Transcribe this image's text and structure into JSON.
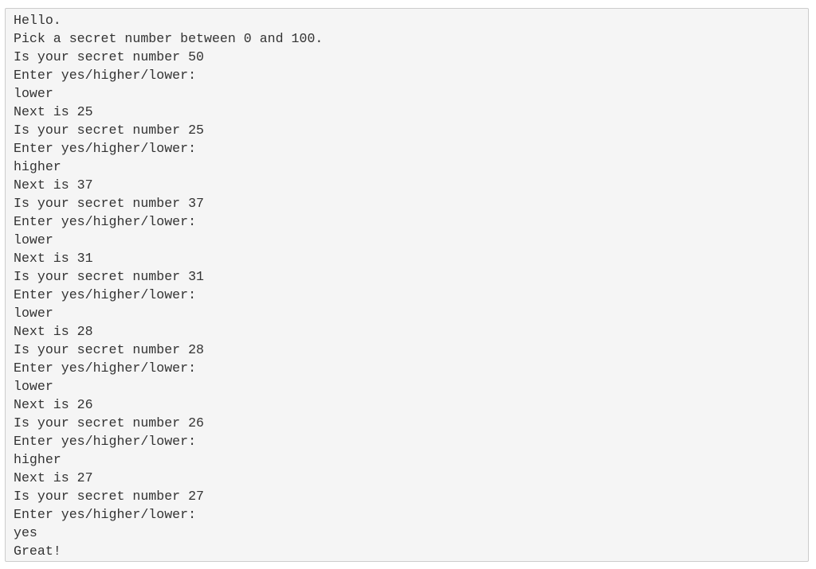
{
  "console": {
    "lines": [
      "Hello.",
      "Pick a secret number between 0 and 100.",
      "Is your secret number 50",
      "Enter yes/higher/lower:",
      "lower",
      "Next is 25",
      "Is your secret number 25",
      "Enter yes/higher/lower:",
      "higher",
      "Next is 37",
      "Is your secret number 37",
      "Enter yes/higher/lower:",
      "lower",
      "Next is 31",
      "Is your secret number 31",
      "Enter yes/higher/lower:",
      "lower",
      "Next is 28",
      "Is your secret number 28",
      "Enter yes/higher/lower:",
      "lower",
      "Next is 26",
      "Is your secret number 26",
      "Enter yes/higher/lower:",
      "higher",
      "Next is 27",
      "Is your secret number 27",
      "Enter yes/higher/lower:",
      "yes",
      "Great!"
    ]
  }
}
